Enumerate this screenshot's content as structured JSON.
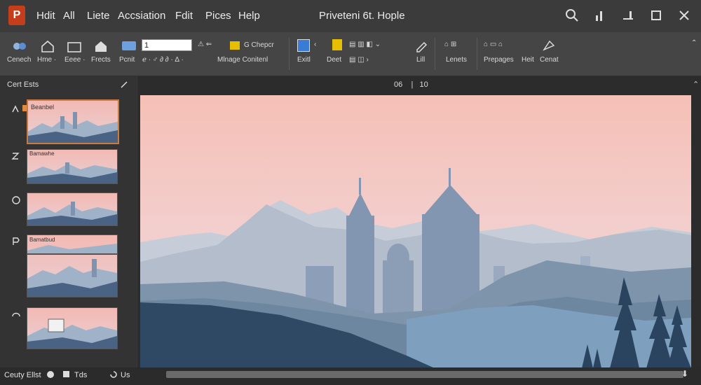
{
  "app": {
    "logo_letter": "P"
  },
  "menu": [
    "Hdit",
    "All",
    "Liete",
    "Accsiation",
    "Fdit",
    "Pices",
    "Help"
  ],
  "document_title": "Priveteni 6t. Hople",
  "ribbon": {
    "groups_row1": [
      {
        "label": "Cenech"
      },
      {
        "label": "Hme ·"
      },
      {
        "label": "Eeee ·"
      },
      {
        "label": "Frects"
      },
      {
        "label": "Pcnit"
      }
    ],
    "font_input_value": "1",
    "cheper_label": "G Chepcr",
    "manage_label": "Mlnage Conitenl",
    "tools": [
      {
        "label": "Exitl"
      },
      {
        "label": "Deet"
      },
      {
        "label": "Lill"
      },
      {
        "label": "Lenets"
      },
      {
        "label": "Prepages"
      },
      {
        "label": "Heit"
      },
      {
        "label": "Cenat"
      }
    ]
  },
  "left_panel": {
    "title": "Cert Ests",
    "thumb_label_1": "Beanbel",
    "thumb_label_2": "Bamawhe",
    "thumb_label_4": "Bamatbud"
  },
  "page_indicator": {
    "current": "06",
    "sep": "|",
    "total": "10"
  },
  "status": {
    "left": "Ceuty Ellst",
    "mid": "Tds",
    "right": "Us"
  },
  "colors": {
    "accent": "#c43e1c",
    "selection": "#c97a3c"
  }
}
